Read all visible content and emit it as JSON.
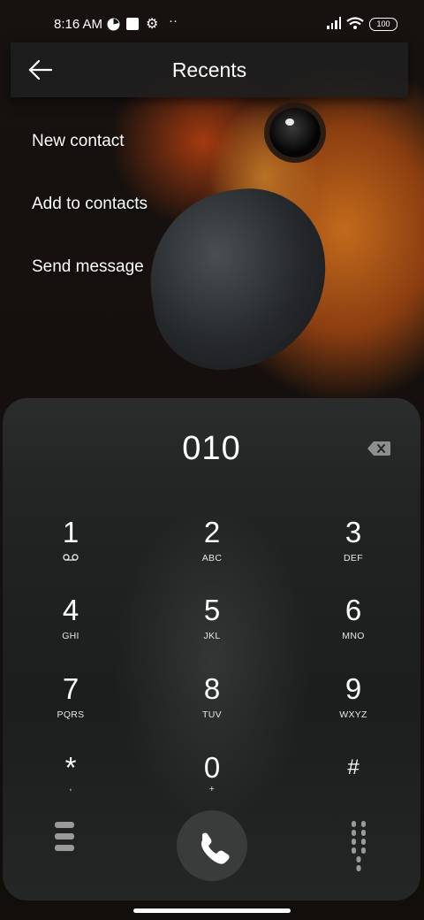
{
  "status_bar": {
    "time": "8:16 AM",
    "battery": "100",
    "icons": [
      "pie-app-icon",
      "square-app-icon",
      "settings-icon",
      "more-dots-icon",
      "signal-icon",
      "wifi-icon",
      "battery-icon"
    ]
  },
  "app_bar": {
    "title": "Recents",
    "back_icon": "arrow-left-icon"
  },
  "menu": {
    "items": [
      "New contact",
      "Add to contacts",
      "Send message"
    ]
  },
  "dialer": {
    "number": "010",
    "backspace_icon": "backspace-icon",
    "keys": [
      {
        "digit": "1",
        "letters": "voicemail-icon"
      },
      {
        "digit": "2",
        "letters": "ABC"
      },
      {
        "digit": "3",
        "letters": "DEF"
      },
      {
        "digit": "4",
        "letters": "GHI"
      },
      {
        "digit": "5",
        "letters": "JKL"
      },
      {
        "digit": "6",
        "letters": "MNO"
      },
      {
        "digit": "7",
        "letters": "PQRS"
      },
      {
        "digit": "8",
        "letters": "TUV"
      },
      {
        "digit": "9",
        "letters": "WXYZ"
      },
      {
        "digit": "*",
        "letters": ","
      },
      {
        "digit": "0",
        "letters": "+"
      },
      {
        "digit": "#",
        "letters": ""
      }
    ],
    "bottom": {
      "left_icon": "menu-lines-icon",
      "call_icon": "phone-icon",
      "right_icon": "dialpad-toggle-icon"
    }
  },
  "colors": {
    "panel": "#232525",
    "accent": "#ffffff",
    "call_button": "#3a3c3c"
  }
}
